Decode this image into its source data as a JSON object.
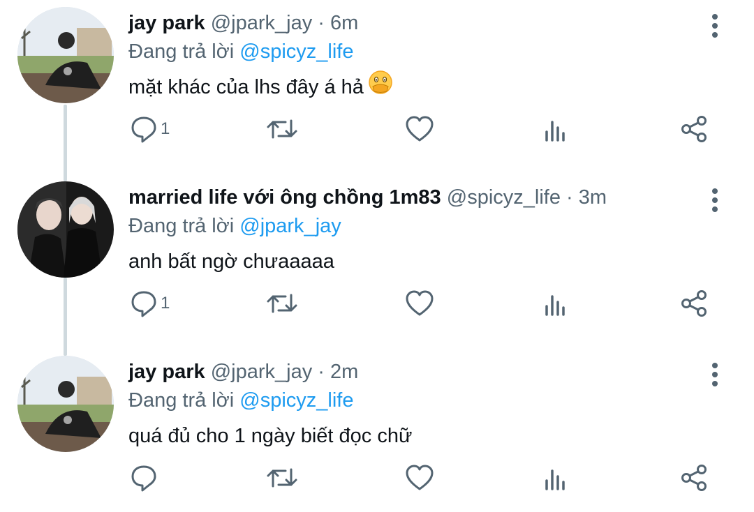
{
  "tweets": [
    {
      "name": "jay park",
      "handle": "@jpark_jay",
      "separator": "·",
      "time": "6m",
      "reply_prefix": "Đang trả lời",
      "reply_to": "@spicyz_life",
      "text": "mặt khác của lhs đây á hả",
      "emoji": "face-with-hand-over-mouth-emoji",
      "reply_count": "1"
    },
    {
      "name": "married life với ông chồng 1m83",
      "handle": "@spicyz_life",
      "separator": "·",
      "time": "3m",
      "reply_prefix": "Đang trả lời",
      "reply_to": "@jpark_jay",
      "text": "anh bất ngờ chưaaaaa",
      "reply_count": "1"
    },
    {
      "name": "jay park",
      "handle": "@jpark_jay",
      "separator": "·",
      "time": "2m",
      "reply_prefix": "Đang trả lời",
      "reply_to": "@spicyz_life",
      "text": "quá đủ cho 1 ngày biết đọc chữ",
      "reply_count": ""
    }
  ],
  "icons": {
    "reply": "reply-icon",
    "retweet": "retweet-icon",
    "like": "like-icon",
    "views": "views-icon",
    "share": "share-icon",
    "more": "more-options-icon"
  },
  "colors": {
    "text_primary": "#0f1419",
    "text_secondary": "#536471",
    "mention": "#1d9bf0",
    "thread_line": "#cfd9de"
  }
}
